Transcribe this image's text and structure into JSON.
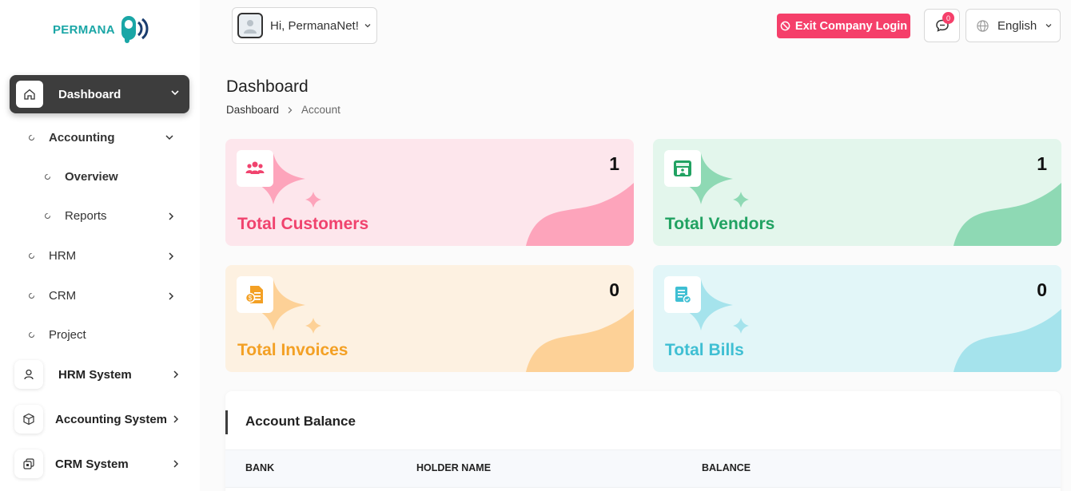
{
  "brand": {
    "logo_text": "PERMANA"
  },
  "header": {
    "user_greeting": "Hi, PermanaNet!",
    "exit_label": "Exit Company Login",
    "messages_badge": "0",
    "language": "English"
  },
  "sidebar": {
    "active": {
      "label": "Dashboard"
    },
    "items": [
      {
        "label": "Accounting"
      },
      {
        "label": "Overview"
      },
      {
        "label": "Reports"
      },
      {
        "label": "HRM"
      },
      {
        "label": "CRM"
      },
      {
        "label": "Project"
      }
    ],
    "systems": [
      {
        "label": "HRM System"
      },
      {
        "label": "Accounting System"
      },
      {
        "label": "CRM System"
      }
    ]
  },
  "page": {
    "title": "Dashboard",
    "breadcrumb": [
      "Dashboard",
      "Account"
    ]
  },
  "stats": [
    {
      "label": "Total Customers",
      "value": "1",
      "color": "#f0436e",
      "bg": "#fde6ec",
      "accent": "#fda4bb"
    },
    {
      "label": "Total Vendors",
      "value": "1",
      "color": "#21a262",
      "bg": "#e3f6ec",
      "accent": "#8ed9b4"
    },
    {
      "label": "Total Invoices",
      "value": "0",
      "color": "#f3a024",
      "bg": "#fdf1e1",
      "accent": "#fdd197"
    },
    {
      "label": "Total Bills",
      "value": "0",
      "color": "#3fbfd3",
      "bg": "#e2f6f8",
      "accent": "#a5e3ec"
    }
  ],
  "balance": {
    "title": "Account Balance",
    "columns": [
      "BANK",
      "HOLDER NAME",
      "BALANCE"
    ]
  }
}
